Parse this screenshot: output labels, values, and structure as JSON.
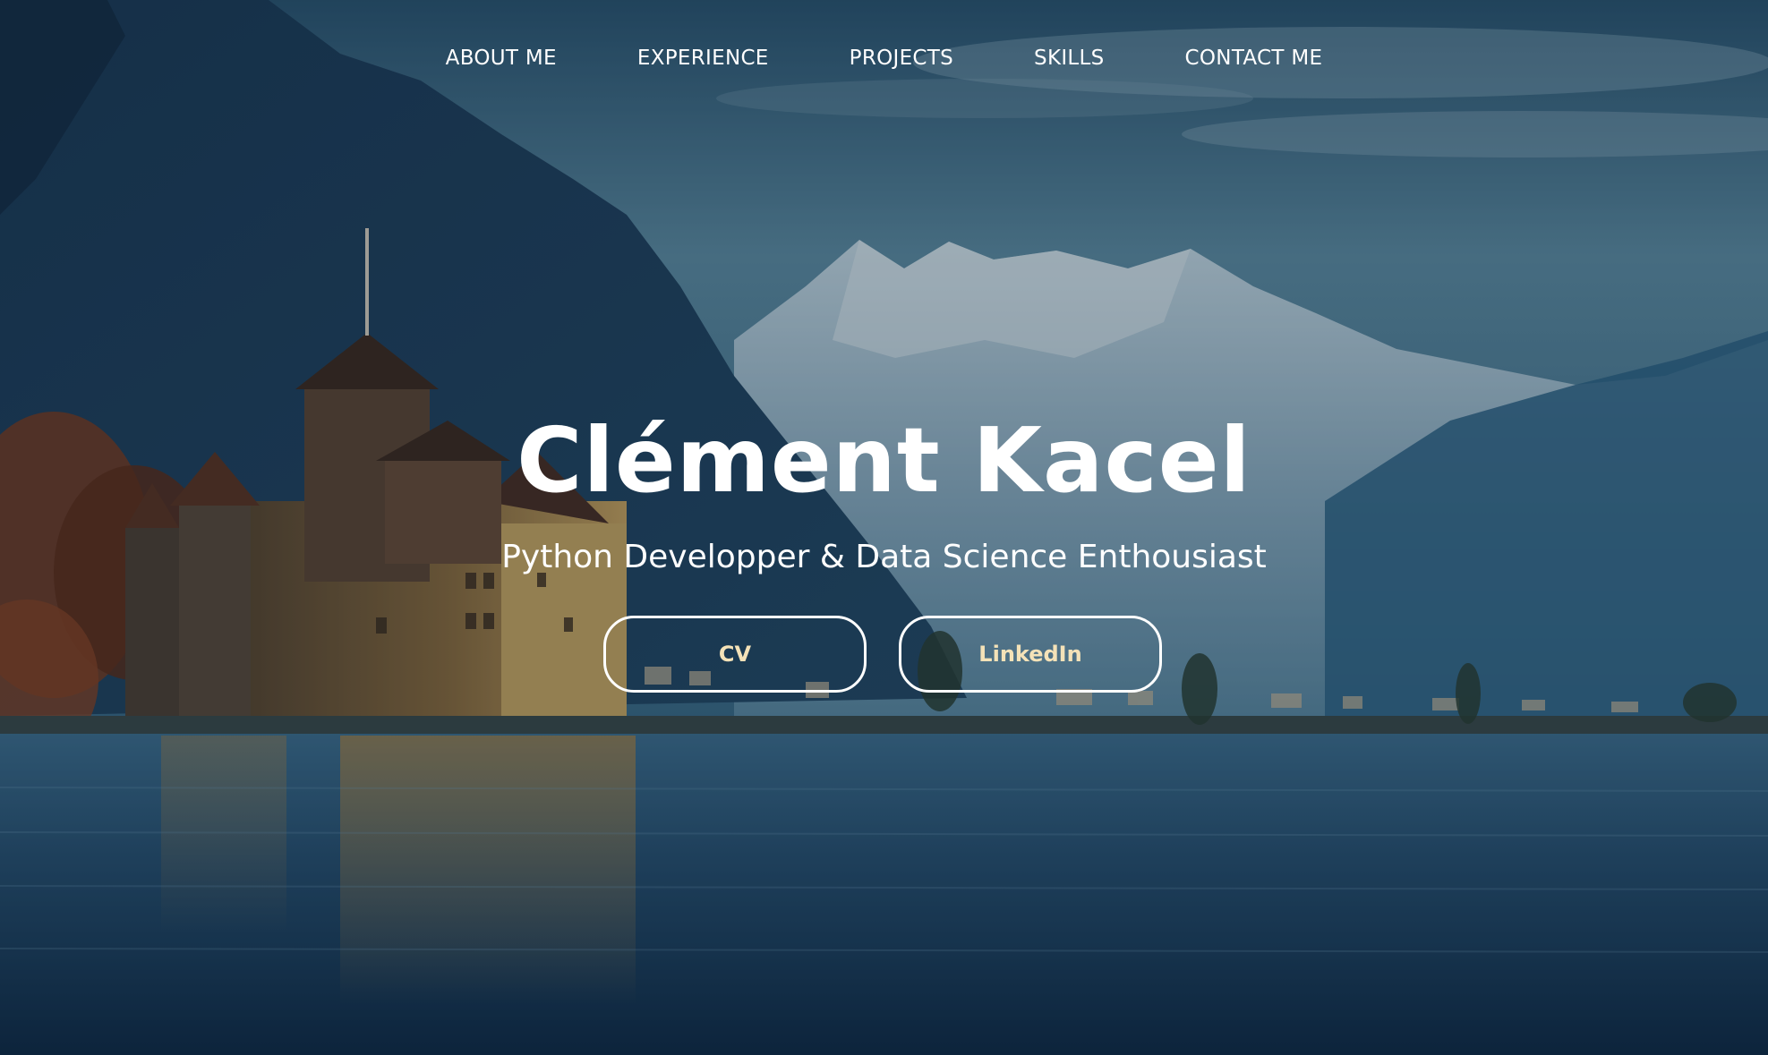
{
  "nav": {
    "items": [
      {
        "label": "ABOUT ME"
      },
      {
        "label": "EXPERIENCE"
      },
      {
        "label": "PROJECTS"
      },
      {
        "label": "SKILLS"
      },
      {
        "label": "CONTACT ME"
      }
    ]
  },
  "hero": {
    "title": "Clément Kacel",
    "subtitle": "Python Developper & Data Science Enthousiast",
    "buttons": {
      "cv_label": "CV",
      "linkedin_label": "LinkedIn"
    }
  },
  "colors": {
    "sky": "#5d8aa0",
    "water": "#1f4a6b",
    "button_text": "#f4e2b8",
    "text": "#ffffff"
  }
}
